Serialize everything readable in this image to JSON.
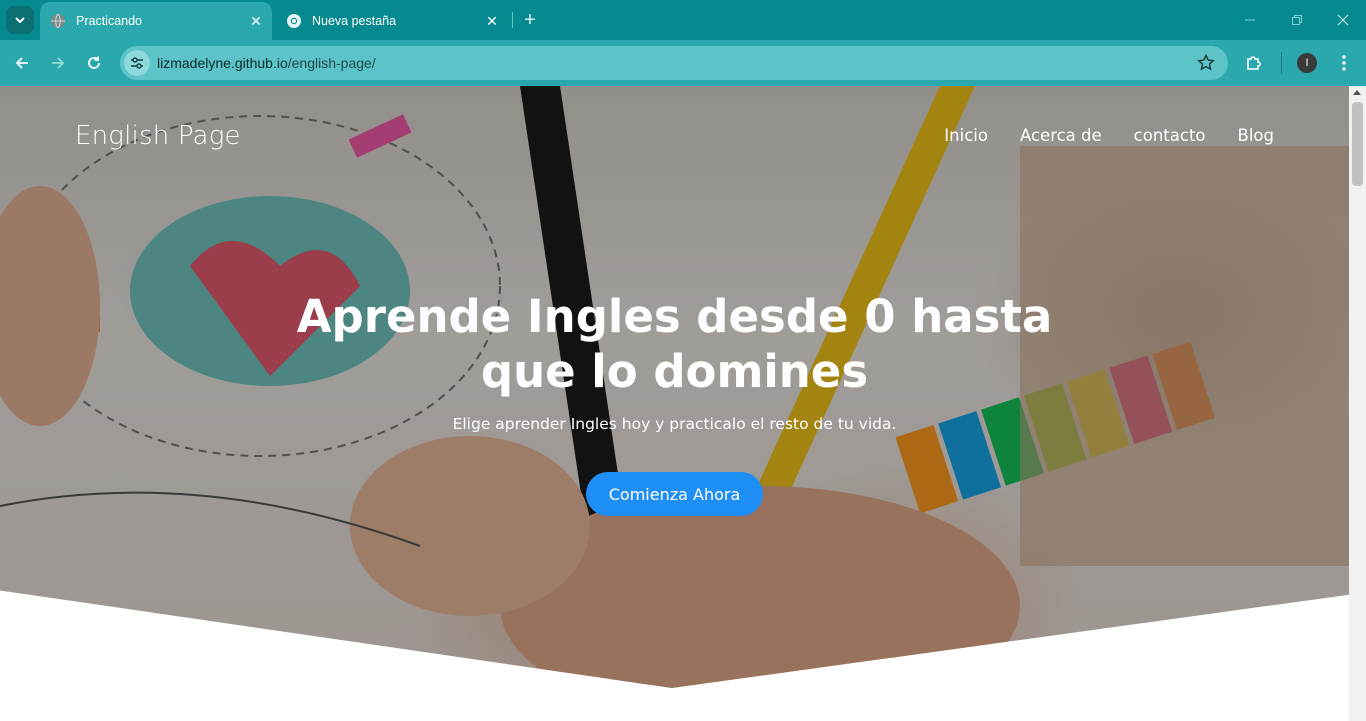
{
  "browser": {
    "tabs": [
      {
        "title": "Practicando",
        "active": true
      },
      {
        "title": "Nueva pestaña",
        "active": false
      }
    ],
    "address": {
      "host": "lizmadelyne.github.io",
      "path": "/english-page/"
    },
    "profile_initial": "I",
    "colors": {
      "frame": "#078a8f",
      "toolbar": "#2aa8ad",
      "omnibox": "#5cc4c8"
    }
  },
  "page": {
    "brand": "English Page",
    "nav": [
      "Inicio",
      "Acerca de",
      "contacto",
      "Blog"
    ],
    "hero": {
      "title_line1": "Aprende Ingles desde 0 hasta",
      "title_line2": "que lo domines",
      "subtitle": "Elige aprender Ingles hoy y practicalo el resto de tu vida.",
      "cta": "Comienza Ahora"
    },
    "colors": {
      "cta": "#1f8ff5"
    }
  }
}
